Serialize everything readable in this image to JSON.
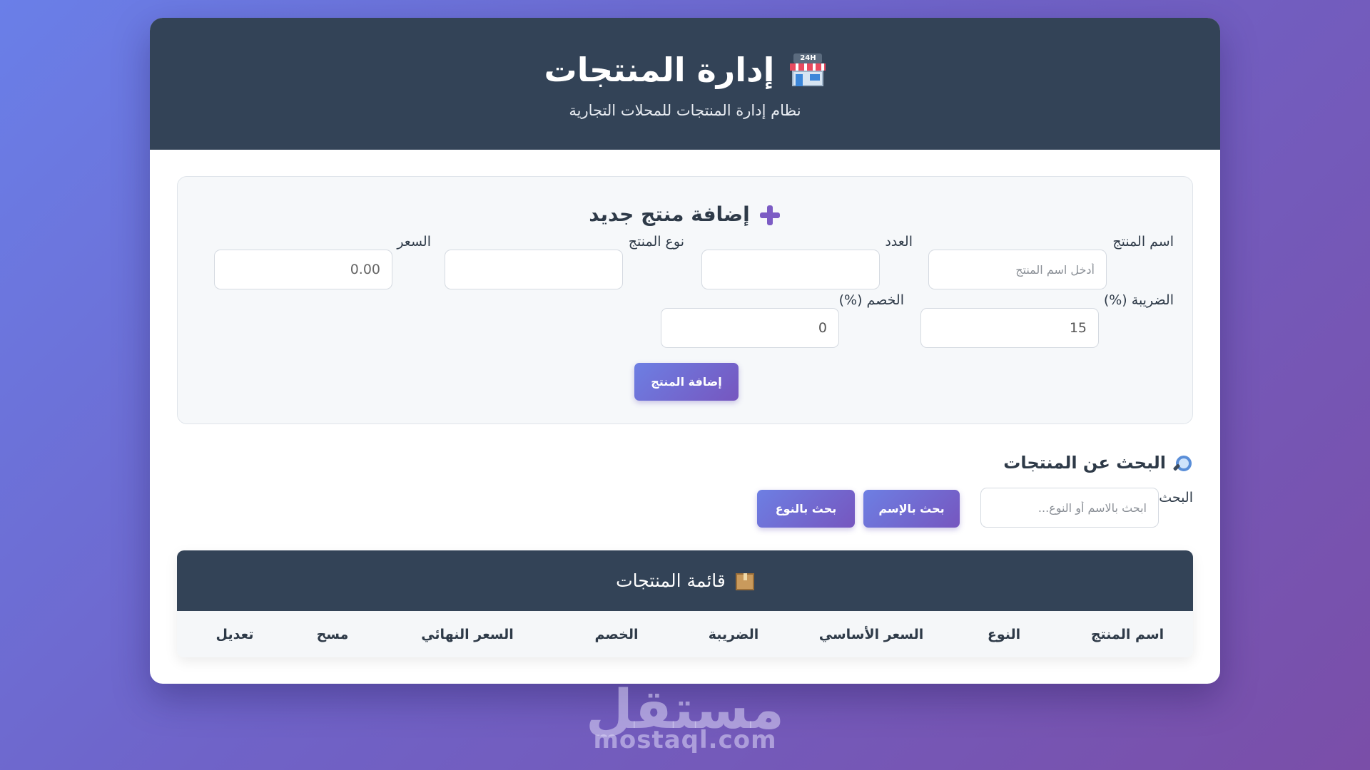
{
  "header": {
    "title": "إدارة المنتجات",
    "subtitle": "نظام إدارة المنتجات للمحلات التجارية"
  },
  "add_form": {
    "title": "إضافة منتج جديد",
    "name_label": "اسم المنتج",
    "name_placeholder": "أدخل اسم المنتج",
    "count_label": "العدد",
    "type_label": "نوع المنتج",
    "price_label": "السعر",
    "price_value": "0.00",
    "tax_label": "الضريبة (%)",
    "tax_value": "15",
    "discount_label": "الخصم (%)",
    "discount_value": "0",
    "submit_label": "إضافة المنتج"
  },
  "search": {
    "title": "البحث عن المنتجات",
    "label": "البحث",
    "placeholder": "ابحث بالاسم أو النوع...",
    "by_name_label": "بحث بالإسم",
    "by_type_label": "بحث بالنوع"
  },
  "products_table": {
    "title": "قائمة المنتجات",
    "columns": [
      "اسم المنتج",
      "النوع",
      "السعر الأساسي",
      "الضريبة",
      "الخصم",
      "السعر النهائي",
      "مسح",
      "تعديل"
    ]
  },
  "watermark": {
    "arabic": "مستقل",
    "latin": "mostaql.com"
  },
  "colors": {
    "header_bg": "#334357",
    "accent_start": "#6d7fe3",
    "accent_end": "#7656bf"
  }
}
